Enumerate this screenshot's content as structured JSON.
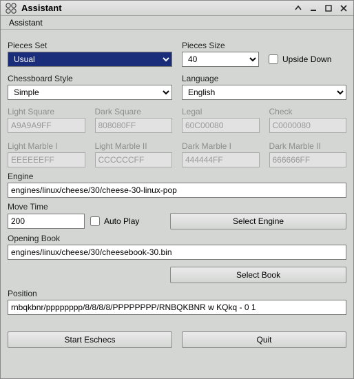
{
  "window": {
    "title": "Assistant"
  },
  "menubar": {
    "assistant": "Assistant"
  },
  "labels": {
    "pieces_set": "Pieces Set",
    "pieces_size": "Pieces Size",
    "upside_down": "Upside Down",
    "chessboard_style": "Chessboard Style",
    "language": "Language",
    "light_square": "Light Square",
    "dark_square": "Dark Square",
    "legal": "Legal",
    "check": "Check",
    "light_marble1": "Light Marble I",
    "light_marble2": "Light Marble II",
    "dark_marble1": "Dark Marble I",
    "dark_marble2": "Dark Marble II",
    "engine": "Engine",
    "move_time": "Move Time",
    "auto_play": "Auto Play",
    "select_engine": "Select Engine",
    "opening_book": "Opening Book",
    "select_book": "Select Book",
    "position": "Position",
    "start_eschecs": "Start Eschecs",
    "quit": "Quit"
  },
  "values": {
    "pieces_set": "Usual",
    "pieces_size": "40",
    "chessboard_style": "Simple",
    "language": "English",
    "light_square": "A9A9A9FF",
    "dark_square": "808080FF",
    "legal": "60C00080",
    "check": "C0000080",
    "light_marble1": "EEEEEEFF",
    "light_marble2": "CCCCCCFF",
    "dark_marble1": "444444FF",
    "dark_marble2": "666666FF",
    "engine": "engines/linux/cheese/30/cheese-30-linux-pop",
    "move_time": "200",
    "opening_book": "engines/linux/cheese/30/cheesebook-30.bin",
    "position": "rnbqkbnr/pppppppp/8/8/8/8/PPPPPPPP/RNBQKBNR w KQkq - 0 1"
  }
}
